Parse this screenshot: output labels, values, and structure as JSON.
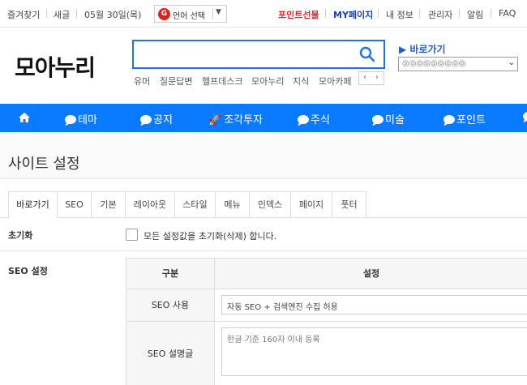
{
  "topbar": {
    "bookmark": "즐겨찾기",
    "new_posts": "새글",
    "date": "05월 30일(목)",
    "language_select": "언어 선택",
    "points_gift": "포인트선물",
    "my_page": "MY페이지",
    "my_info": "내 정보",
    "admin": "관리자",
    "notifications": "알림",
    "faq": "FAQ"
  },
  "logo": "모아누리",
  "search": {
    "placeholder": "",
    "quicklinks": [
      "유머",
      "질문답변",
      "헬프데스크",
      "모아누리",
      "지식",
      "모아카페"
    ]
  },
  "goto": {
    "label": "▶ 바로가기",
    "selected": "◎◎◎◎◎◎◎◎◎"
  },
  "nav": {
    "items": [
      "테마",
      "공지",
      "조각투자",
      "주식",
      "미술",
      "포인트"
    ]
  },
  "page": {
    "title": "사이트 설정"
  },
  "tabs": [
    "바로가기",
    "SEO",
    "기본",
    "레이아웃",
    "스타일",
    "메뉴",
    "인덱스",
    "페이지",
    "풋터"
  ],
  "settings": {
    "reset_label": "초기화",
    "reset_checkbox_text": "모든 설정값을 초기화(삭제) 합니다.",
    "seo_label": "SEO 설정",
    "table": {
      "col_type": "구분",
      "col_setting": "설정",
      "rows": [
        {
          "label": "SEO 사용",
          "value": "자동 SEO + 검색엔진 수집 허용"
        },
        {
          "label": "SEO 설명글",
          "placeholder": "한글 기준 160자 이내 등록"
        }
      ]
    }
  },
  "colors": {
    "accent": "#0a7bff",
    "search_border": "#1d73e8",
    "points_gift": "#e8252c",
    "my_page": "#1d3fb8"
  }
}
